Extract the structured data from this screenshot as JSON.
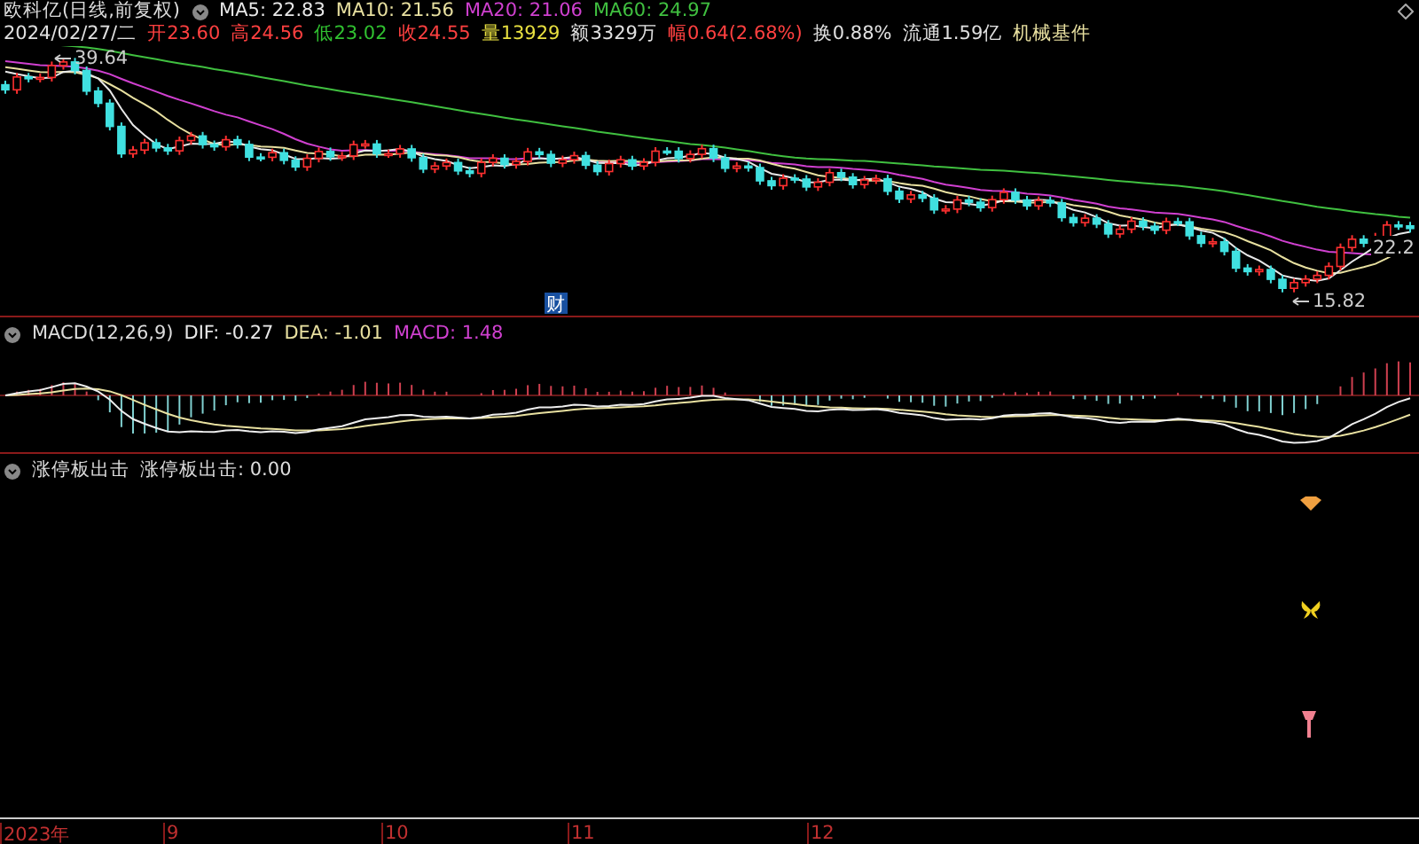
{
  "title_bar": {
    "stock": "欧科亿(日线,前复权)",
    "ma_legend": [
      {
        "text": "MA5: 22.83",
        "color": "#e8e8e8"
      },
      {
        "text": "MA10: 21.56",
        "color": "#e8e0a0"
      },
      {
        "text": "MA20: 21.06",
        "color": "#d040d0"
      },
      {
        "text": "MA60: 24.97",
        "color": "#40c040"
      }
    ]
  },
  "quote_bar": [
    {
      "text": "2024/02/27/二",
      "color": "#e0e0e0"
    },
    {
      "text": "开23.60",
      "color": "#ff4040"
    },
    {
      "text": "高24.56",
      "color": "#ff4040"
    },
    {
      "text": "低23.02",
      "color": "#30c030"
    },
    {
      "text": "收24.55",
      "color": "#ff4040"
    },
    {
      "text": "量13929",
      "color": "#e8e040"
    },
    {
      "text": "额3329万",
      "color": "#e0e0e0"
    },
    {
      "text": "幅0.64(2.68%)",
      "color": "#ff4040"
    },
    {
      "text": "换0.88%",
      "color": "#e0e0e0"
    },
    {
      "text": "流通1.59亿",
      "color": "#e0e0e0"
    },
    {
      "text": "机械基件",
      "color": "#e8e0a0"
    }
  ],
  "price_panel": {
    "high_label": "39.64",
    "low_label": "15.82",
    "right_label": "22.2",
    "event_marker": "财"
  },
  "macd_panel": {
    "name": "MACD(12,26,9)",
    "values": [
      {
        "text": "DIF: -0.27",
        "color": "#e8e8e8"
      },
      {
        "text": "DEA: -1.01",
        "color": "#e8e0a0"
      },
      {
        "text": "MACD: 1.48",
        "color": "#d040d0"
      }
    ]
  },
  "signal_panel": {
    "name": "涨停板出击",
    "value": "涨停板出击: 0.00"
  },
  "time_axis": [
    "2023年",
    "9",
    "10",
    "11",
    "12"
  ]
}
